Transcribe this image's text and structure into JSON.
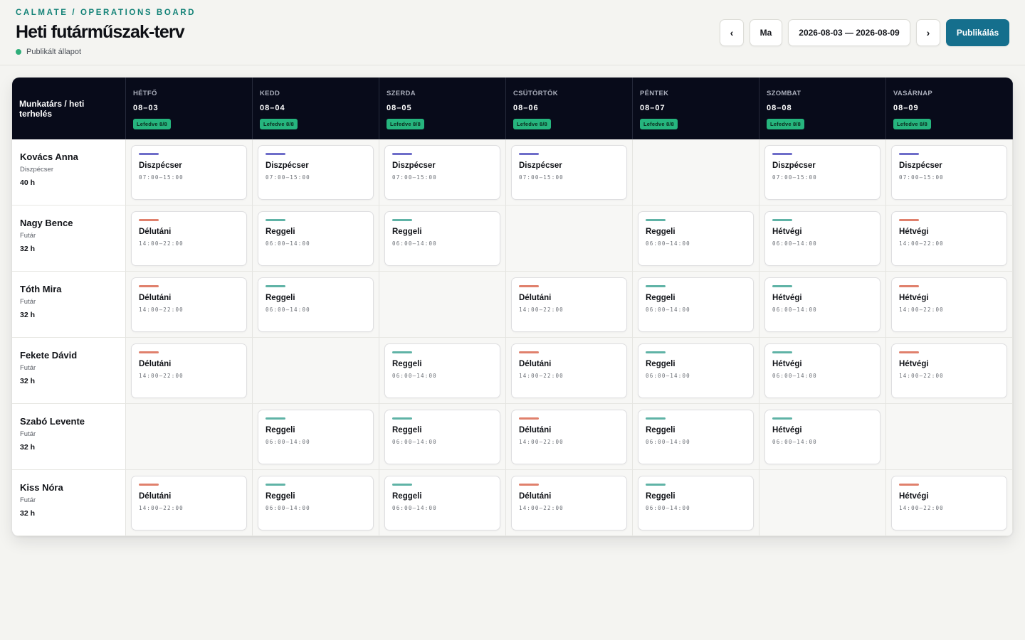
{
  "header": {
    "eyebrow": "CALMATE / OPERATIONS BOARD",
    "title": "Heti futárműszak-terv",
    "status": "Publikált állapot"
  },
  "toolbar": {
    "prev_label": "‹",
    "today_label": "Ma",
    "range_label": "2026-08-03 — 2026-08-09",
    "next_label": "›",
    "publish_label": "Publikálás"
  },
  "board": {
    "corner_label": "Munkatárs / heti terhelés",
    "days": [
      {
        "name": "HÉTFŐ",
        "date": "08–03",
        "coverage": "Lefedve 8/8"
      },
      {
        "name": "KEDD",
        "date": "08–04",
        "coverage": "Lefedve 8/8"
      },
      {
        "name": "SZERDA",
        "date": "08–05",
        "coverage": "Lefedve 8/8"
      },
      {
        "name": "CSÜTÖRTÖK",
        "date": "08–06",
        "coverage": "Lefedve 8/8"
      },
      {
        "name": "PÉNTEK",
        "date": "08–07",
        "coverage": "Lefedve 8/8"
      },
      {
        "name": "SZOMBAT",
        "date": "08–08",
        "coverage": "Lefedve 8/8"
      },
      {
        "name": "VASÁRNAP",
        "date": "08–09",
        "coverage": "Lefedve 8/8"
      }
    ],
    "people": [
      {
        "name": "Kovács Anna",
        "role": "Diszpécser",
        "hours": "40 h"
      },
      {
        "name": "Nagy Bence",
        "role": "Futár",
        "hours": "32 h"
      },
      {
        "name": "Tóth Mira",
        "role": "Futár",
        "hours": "32 h"
      },
      {
        "name": "Fekete Dávid",
        "role": "Futár",
        "hours": "32 h"
      },
      {
        "name": "Szabó Levente",
        "role": "Futár",
        "hours": "32 h"
      },
      {
        "name": "Kiss Nóra",
        "role": "Futár",
        "hours": "32 h"
      }
    ]
  },
  "shift_types": {
    "D": {
      "name": "Diszpécser",
      "time": "07:00–15:00",
      "color": "#6e6dc9"
    },
    "R": {
      "name": "Reggeli",
      "time": "06:00–14:00",
      "color": "#5fb3a6"
    },
    "U": {
      "name": "Délutáni",
      "time": "14:00–22:00",
      "color": "#e0806c"
    },
    "HR": {
      "name": "Hétvégi",
      "time": "06:00–14:00",
      "color": "#5fb3a6"
    },
    "HU": {
      "name": "Hétvégi",
      "time": "14:00–22:00",
      "color": "#e0806c"
    }
  },
  "schedule": [
    [
      "D",
      "D",
      "D",
      "D",
      null,
      "D",
      "D"
    ],
    [
      "U",
      "R",
      "R",
      null,
      "R",
      "HR",
      "HU"
    ],
    [
      "U",
      "R",
      null,
      "U",
      "R",
      "HR",
      "HU"
    ],
    [
      "U",
      null,
      "R",
      "U",
      "R",
      "HR",
      "HU"
    ],
    [
      null,
      "R",
      "R",
      "U",
      "R",
      "HR",
      null
    ],
    [
      "U",
      "R",
      "R",
      "U",
      "R",
      null,
      "HU"
    ]
  ]
}
